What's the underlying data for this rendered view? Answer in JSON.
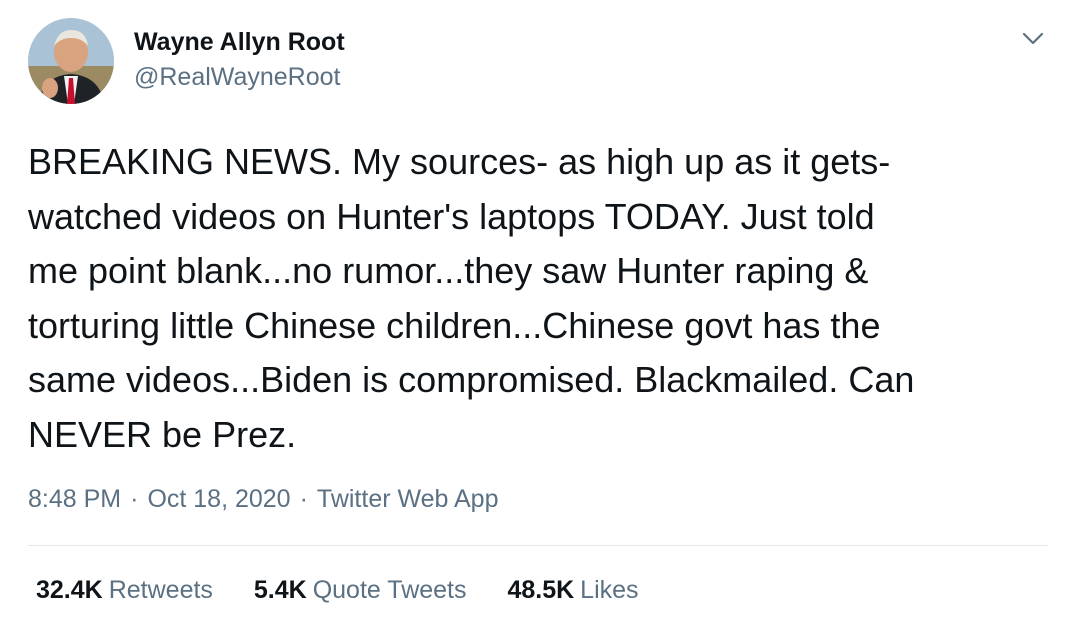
{
  "author": {
    "name": "Wayne Allyn Root",
    "handle": "@RealWayneRoot"
  },
  "tweet": {
    "lines": [
      "BREAKING NEWS. My sources- as high up as it gets-",
      "watched videos on Hunter's laptops TODAY. Just told",
      "me point blank...no rumor...they saw Hunter raping &",
      "torturing little Chinese children...Chinese govt has the",
      "same videos...Biden is compromised. Blackmailed. Can",
      "NEVER be Prez."
    ],
    "time": "8:48 PM",
    "date": "Oct 18, 2020",
    "source": "Twitter Web App",
    "separator": "·"
  },
  "stats": {
    "retweets_count": "32.4K",
    "retweets_label": "Retweets",
    "quotes_count": "5.4K",
    "quotes_label": "Quote Tweets",
    "likes_count": "48.5K",
    "likes_label": "Likes"
  },
  "icons": {
    "menu": "chevron-down-icon",
    "avatar": "avatar"
  },
  "colors": {
    "text": "#0f1419",
    "secondary": "#5b7083",
    "divider": "#e1e8ed"
  }
}
